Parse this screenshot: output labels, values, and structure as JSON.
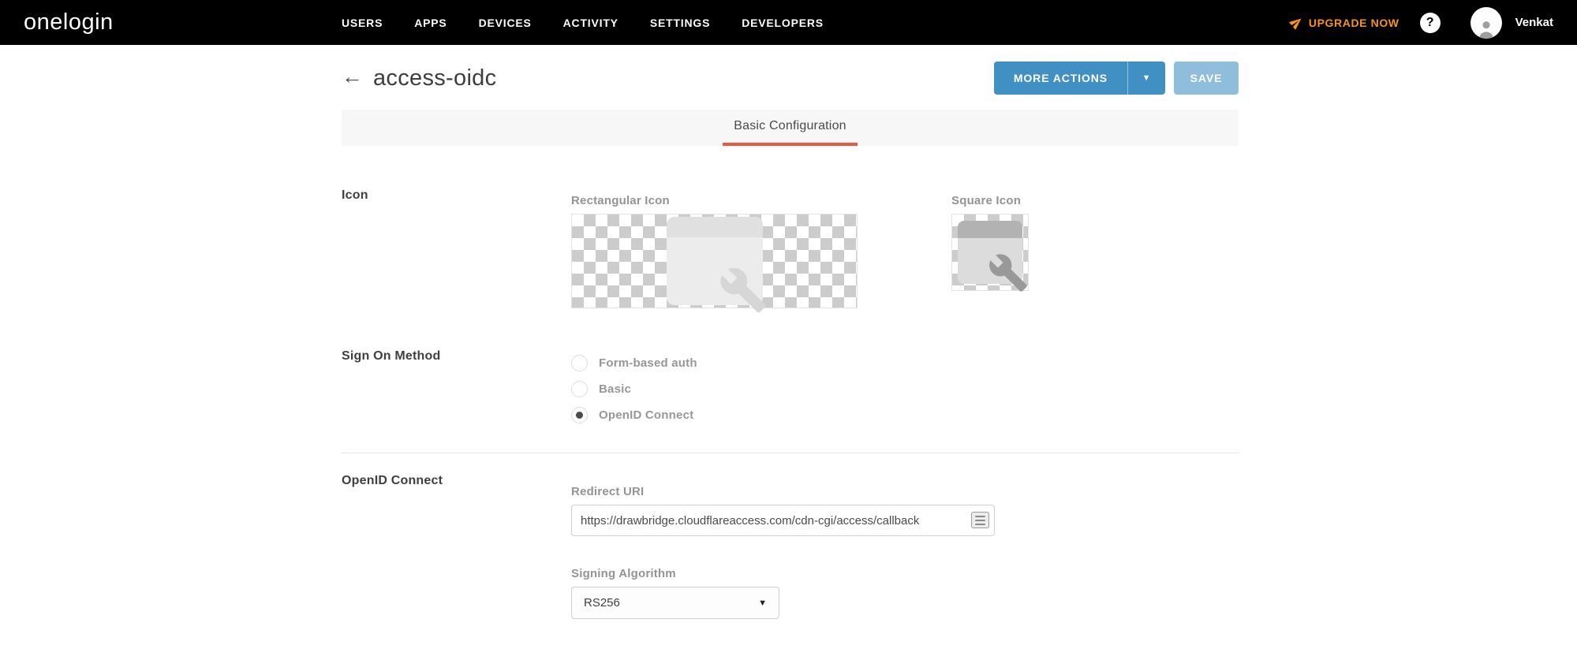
{
  "navbar": {
    "logo": "onelogin",
    "items": [
      {
        "label": "USERS"
      },
      {
        "label": "APPS"
      },
      {
        "label": "DEVICES"
      },
      {
        "label": "ACTIVITY"
      },
      {
        "label": "SETTINGS"
      },
      {
        "label": "DEVELOPERS"
      }
    ],
    "upgrade_label": "UPGRADE NOW",
    "help_glyph": "?",
    "username": "Venkat"
  },
  "header": {
    "back_arrow": "←",
    "title": "access-oidc",
    "more_actions_label": "MORE ACTIONS",
    "more_actions_caret": "▼",
    "save_label": "SAVE"
  },
  "tabs": {
    "active_label": "Basic Configuration"
  },
  "form": {
    "icon_section": {
      "label": "Icon",
      "rectangular_label": "Rectangular Icon",
      "square_label": "Square Icon"
    },
    "sign_on": {
      "label": "Sign On Method",
      "options": [
        {
          "label": "Form-based auth",
          "selected": false
        },
        {
          "label": "Basic",
          "selected": false
        },
        {
          "label": "OpenID Connect",
          "selected": true
        }
      ]
    },
    "oidc": {
      "label": "OpenID Connect",
      "redirect_uri_label": "Redirect URI",
      "redirect_uri_value": "https://drawbridge.cloudflareaccess.com/cdn-cgi/access/callback",
      "signing_label": "Signing Algorithm",
      "signing_value": "RS256",
      "select_caret": "▼"
    }
  },
  "colors": {
    "navbar_bg": "#000000",
    "upgrade_orange": "#F7941E",
    "primary_button_blue": "#4190C4",
    "save_button_blue": "#8FBEDC",
    "tab_underline_red": "#ED5742",
    "tab_bar_bg": "#F7F7F7"
  }
}
